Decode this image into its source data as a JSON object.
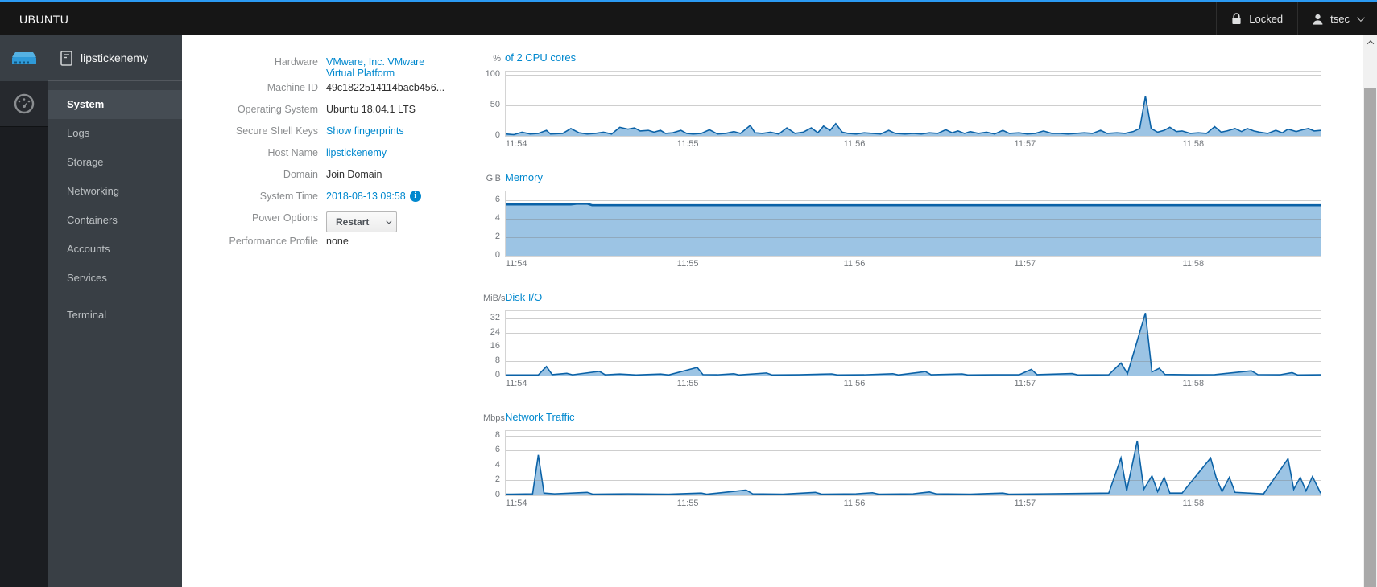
{
  "colors": {
    "accent": "#2b9af3",
    "link": "#0088ce",
    "chart_line": "#0b62a7",
    "chart_fill": "#9cc4e4"
  },
  "topbar": {
    "brand": "UBUNTU",
    "locked_label": "Locked",
    "user": "tsec"
  },
  "sidebar": {
    "host": "lipstickenemy",
    "items": [
      {
        "label": "System",
        "active": true
      },
      {
        "label": "Logs"
      },
      {
        "label": "Storage"
      },
      {
        "label": "Networking"
      },
      {
        "label": "Containers"
      },
      {
        "label": "Accounts"
      },
      {
        "label": "Services"
      },
      {
        "label": "Terminal",
        "gap": true
      }
    ]
  },
  "info": {
    "rows": [
      {
        "label": "Hardware",
        "type": "link",
        "lines": [
          "VMware, Inc. VMware",
          "Virtual Platform"
        ]
      },
      {
        "label": "Machine ID",
        "type": "text",
        "value": "49c1822514114bacb456..."
      },
      {
        "label": "Operating System",
        "type": "text",
        "value": "Ubuntu 18.04.1 LTS"
      },
      {
        "label": "Secure Shell Keys",
        "type": "link",
        "value": "Show fingerprints"
      },
      {
        "label": "Host Name",
        "type": "link",
        "value": "lipstickenemy"
      },
      {
        "label": "Domain",
        "type": "text",
        "value": "Join Domain"
      },
      {
        "label": "System Time",
        "type": "link",
        "value": "2018-08-13 09:58",
        "info_icon": true
      },
      {
        "label": "Power Options",
        "type": "button",
        "value": "Restart"
      },
      {
        "label": "Performance Profile",
        "type": "text",
        "value": "none"
      }
    ]
  },
  "chart_data": [
    {
      "type": "area",
      "unit": "%",
      "title": "of 2 CPU cores",
      "ylim": [
        0,
        105
      ],
      "yticks": [
        0,
        50,
        100
      ],
      "grid": true,
      "stroke_width": 1.6,
      "x_labels": [
        "11:54",
        "11:55",
        "11:56",
        "11:57",
        "11:58"
      ],
      "x_label_pos": [
        1.4,
        22.4,
        42.8,
        63.7,
        84.3
      ],
      "points": [
        [
          0,
          3
        ],
        [
          1,
          2
        ],
        [
          2,
          6
        ],
        [
          3,
          3
        ],
        [
          4,
          4
        ],
        [
          5,
          9
        ],
        [
          5.5,
          3
        ],
        [
          7,
          4
        ],
        [
          8,
          12
        ],
        [
          9,
          5
        ],
        [
          10,
          3
        ],
        [
          11,
          4
        ],
        [
          12,
          6
        ],
        [
          13,
          3
        ],
        [
          14,
          14
        ],
        [
          15,
          11
        ],
        [
          15.8,
          13
        ],
        [
          16.5,
          8
        ],
        [
          17.5,
          9
        ],
        [
          18.2,
          6
        ],
        [
          19,
          9
        ],
        [
          19.6,
          4
        ],
        [
          20.5,
          5
        ],
        [
          21.5,
          9
        ],
        [
          22.2,
          4
        ],
        [
          23,
          3
        ],
        [
          24,
          4
        ],
        [
          25,
          10
        ],
        [
          26,
          3
        ],
        [
          27,
          4
        ],
        [
          28,
          7
        ],
        [
          28.8,
          4
        ],
        [
          30,
          17
        ],
        [
          30.6,
          5
        ],
        [
          31.5,
          4
        ],
        [
          32.5,
          6
        ],
        [
          33.5,
          3
        ],
        [
          34.5,
          13
        ],
        [
          35.5,
          4
        ],
        [
          36.5,
          6
        ],
        [
          37.5,
          13
        ],
        [
          38.3,
          5
        ],
        [
          39,
          16
        ],
        [
          39.8,
          9
        ],
        [
          40.5,
          20
        ],
        [
          41.3,
          6
        ],
        [
          42,
          4
        ],
        [
          43,
          3
        ],
        [
          44,
          5
        ],
        [
          45,
          4
        ],
        [
          46,
          3
        ],
        [
          47,
          9
        ],
        [
          47.8,
          4
        ],
        [
          49,
          3
        ],
        [
          50,
          4
        ],
        [
          51,
          3
        ],
        [
          52,
          5
        ],
        [
          53,
          4
        ],
        [
          54,
          10
        ],
        [
          54.8,
          5
        ],
        [
          55.5,
          8
        ],
        [
          56.3,
          4
        ],
        [
          57,
          7
        ],
        [
          58,
          4
        ],
        [
          59,
          6
        ],
        [
          60,
          3
        ],
        [
          61,
          9
        ],
        [
          61.8,
          4
        ],
        [
          63,
          5
        ],
        [
          64,
          3
        ],
        [
          65,
          4
        ],
        [
          66,
          8
        ],
        [
          67,
          4
        ],
        [
          68,
          4
        ],
        [
          69,
          3
        ],
        [
          70,
          4
        ],
        [
          71,
          5
        ],
        [
          72,
          4
        ],
        [
          73,
          9
        ],
        [
          73.8,
          4
        ],
        [
          75,
          5
        ],
        [
          76,
          4
        ],
        [
          77,
          7
        ],
        [
          77.8,
          12
        ],
        [
          78.5,
          65
        ],
        [
          79.2,
          12
        ],
        [
          80,
          6
        ],
        [
          80.8,
          9
        ],
        [
          81.5,
          14
        ],
        [
          82.3,
          7
        ],
        [
          83,
          8
        ],
        [
          84,
          4
        ],
        [
          85,
          5
        ],
        [
          86,
          4
        ],
        [
          87,
          15
        ],
        [
          87.8,
          6
        ],
        [
          88.5,
          8
        ],
        [
          89.5,
          12
        ],
        [
          90.3,
          7
        ],
        [
          91,
          12
        ],
        [
          91.8,
          8
        ],
        [
          92.5,
          6
        ],
        [
          93.5,
          4
        ],
        [
          94.5,
          9
        ],
        [
          95.3,
          5
        ],
        [
          96,
          11
        ],
        [
          97,
          7
        ],
        [
          97.8,
          10
        ],
        [
          98.5,
          12
        ],
        [
          99.2,
          8
        ],
        [
          100,
          9
        ]
      ]
    },
    {
      "type": "area",
      "unit": "GiB",
      "title": "Memory",
      "ylim": [
        0,
        7
      ],
      "yticks": [
        0,
        2,
        4,
        6
      ],
      "grid": true,
      "stroke_width": 2.6,
      "x_labels": [
        "11:54",
        "11:55",
        "11:56",
        "11:57",
        "11:58"
      ],
      "x_label_pos": [
        1.4,
        22.4,
        42.8,
        63.7,
        84.3
      ],
      "points": [
        [
          0,
          5.58
        ],
        [
          8,
          5.58
        ],
        [
          8.7,
          5.66
        ],
        [
          10,
          5.66
        ],
        [
          10.6,
          5.5
        ],
        [
          100,
          5.5
        ]
      ]
    },
    {
      "type": "area",
      "unit": "MiB/s",
      "title": "Disk I/O",
      "ylim": [
        0,
        36
      ],
      "yticks": [
        0,
        8,
        16,
        24,
        32
      ],
      "grid": true,
      "stroke_width": 1.6,
      "x_labels": [
        "11:54",
        "11:55",
        "11:56",
        "11:57",
        "11:58"
      ],
      "x_label_pos": [
        1.4,
        22.4,
        42.8,
        63.7,
        84.3
      ],
      "points": [
        [
          0,
          0.3
        ],
        [
          4,
          0.3
        ],
        [
          5,
          5
        ],
        [
          5.7,
          0.5
        ],
        [
          7.5,
          1.2
        ],
        [
          8.2,
          0.4
        ],
        [
          11.5,
          2.3
        ],
        [
          12.2,
          0.4
        ],
        [
          14,
          0.8
        ],
        [
          16,
          0.3
        ],
        [
          19,
          0.8
        ],
        [
          20,
          0.3
        ],
        [
          23.5,
          4.5
        ],
        [
          24.2,
          0.5
        ],
        [
          26,
          0.4
        ],
        [
          28,
          1
        ],
        [
          28.6,
          0.3
        ],
        [
          32,
          1.4
        ],
        [
          32.7,
          0.3
        ],
        [
          36,
          0.4
        ],
        [
          40,
          0.9
        ],
        [
          40.7,
          0.3
        ],
        [
          44,
          0.4
        ],
        [
          47.5,
          1
        ],
        [
          48.2,
          0.3
        ],
        [
          51.5,
          2.2
        ],
        [
          52.2,
          0.4
        ],
        [
          56,
          0.9
        ],
        [
          56.7,
          0.3
        ],
        [
          60,
          0.4
        ],
        [
          63,
          0.4
        ],
        [
          64.5,
          3.4
        ],
        [
          65.2,
          0.5
        ],
        [
          69.5,
          1.1
        ],
        [
          70.2,
          0.3
        ],
        [
          74,
          0.4
        ],
        [
          75.5,
          7
        ],
        [
          76.3,
          1
        ],
        [
          78.5,
          35
        ],
        [
          79.3,
          2
        ],
        [
          80.2,
          4
        ],
        [
          80.9,
          0.6
        ],
        [
          84,
          0.4
        ],
        [
          87,
          0.5
        ],
        [
          91.5,
          2.6
        ],
        [
          92.3,
          0.5
        ],
        [
          95,
          0.4
        ],
        [
          96.5,
          1.6
        ],
        [
          97.2,
          0.3
        ],
        [
          100,
          0.4
        ]
      ]
    },
    {
      "type": "area",
      "unit": "Mbps",
      "title": "Network Traffic",
      "ylim": [
        0,
        8.6
      ],
      "yticks": [
        0,
        2,
        4,
        6,
        8
      ],
      "grid": true,
      "stroke_width": 1.6,
      "x_labels": [
        "11:54",
        "11:55",
        "11:56",
        "11:57",
        "11:58"
      ],
      "x_label_pos": [
        1.4,
        22.4,
        42.8,
        63.7,
        84.3
      ],
      "points": [
        [
          0,
          0.15
        ],
        [
          3.3,
          0.2
        ],
        [
          4,
          5.4
        ],
        [
          4.7,
          0.3
        ],
        [
          6,
          0.2
        ],
        [
          10,
          0.4
        ],
        [
          10.7,
          0.15
        ],
        [
          15,
          0.2
        ],
        [
          20,
          0.15
        ],
        [
          24,
          0.3
        ],
        [
          24.7,
          0.15
        ],
        [
          29.5,
          0.7
        ],
        [
          30.3,
          0.2
        ],
        [
          34,
          0.15
        ],
        [
          38,
          0.4
        ],
        [
          38.8,
          0.15
        ],
        [
          43,
          0.2
        ],
        [
          45,
          0.35
        ],
        [
          45.8,
          0.15
        ],
        [
          50,
          0.2
        ],
        [
          52,
          0.45
        ],
        [
          52.8,
          0.2
        ],
        [
          57,
          0.15
        ],
        [
          61,
          0.3
        ],
        [
          61.8,
          0.15
        ],
        [
          66,
          0.2
        ],
        [
          70,
          0.25
        ],
        [
          74,
          0.3
        ],
        [
          75.5,
          5
        ],
        [
          76.2,
          0.6
        ],
        [
          77.5,
          7.3
        ],
        [
          78.3,
          0.8
        ],
        [
          79.3,
          2.6
        ],
        [
          80,
          0.5
        ],
        [
          80.8,
          2.4
        ],
        [
          81.5,
          0.3
        ],
        [
          83,
          0.3
        ],
        [
          86.5,
          5
        ],
        [
          87.2,
          2.3
        ],
        [
          87.9,
          0.5
        ],
        [
          88.8,
          2.4
        ],
        [
          89.5,
          0.4
        ],
        [
          93,
          0.2
        ],
        [
          96,
          4.9
        ],
        [
          96.7,
          0.8
        ],
        [
          97.5,
          2.4
        ],
        [
          98.2,
          0.6
        ],
        [
          99,
          2.5
        ],
        [
          100,
          0.3
        ]
      ]
    }
  ]
}
